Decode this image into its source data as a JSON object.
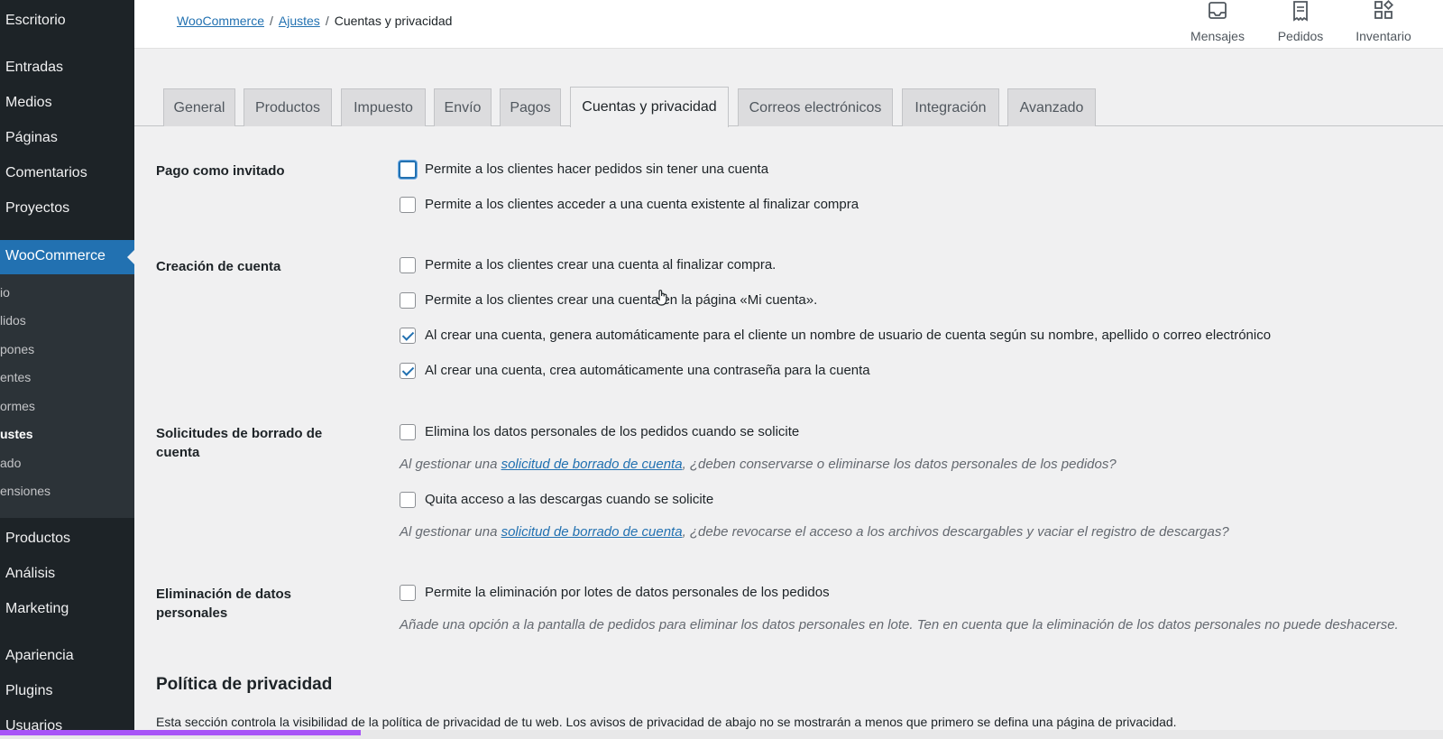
{
  "sidebar": {
    "top_items": [
      "Escritorio",
      "Entradas",
      "Medios",
      "Páginas",
      "Comentarios",
      "Proyectos"
    ],
    "active_item": "WooCommerce",
    "submenu": [
      "io",
      "lidos",
      "pones",
      "entes",
      "ormes",
      "ustes",
      "ado",
      "ensiones"
    ],
    "bottom_items": [
      "Productos",
      "Análisis",
      "Marketing",
      "Apariencia",
      "Plugins",
      "Usuarios"
    ]
  },
  "breadcrumb": {
    "link1": "WooCommerce",
    "link2": "Ajustes",
    "separator": "/",
    "current": "Cuentas y privacidad"
  },
  "top_actions": [
    {
      "label": "Mensajes",
      "icon": "inbox-icon"
    },
    {
      "label": "Pedidos",
      "icon": "orders-icon"
    },
    {
      "label": "Inventario",
      "icon": "inventory-icon"
    }
  ],
  "tabs": [
    "General",
    "Productos",
    "Impuesto",
    "Envío",
    "Pagos",
    "Cuentas y privacidad",
    "Correos electrónicos",
    "Integración",
    "Avanzado"
  ],
  "active_tab": "Cuentas y privacidad",
  "form": {
    "guest": {
      "label": "Pago como invitado",
      "opt1": "Permite a los clientes hacer pedidos sin tener una cuenta",
      "opt2": "Permite a los clientes acceder a una cuenta existente al finalizar compra"
    },
    "creation": {
      "label": "Creación de cuenta",
      "opt1": "Permite a los clientes crear una cuenta al finalizar compra.",
      "opt2": "Permite a los clientes crear una cuenta en la página «Mi cuenta».",
      "opt3": "Al crear una cuenta, genera automáticamente para el cliente un nombre de usuario de cuenta según su nombre, apellido o correo electrónico",
      "opt4": "Al crear una cuenta, crea automáticamente una contraseña para la cuenta"
    },
    "erasure": {
      "label": "Solicitudes de borrado de cuenta",
      "opt1": "Elimina los datos personales de los pedidos cuando se solicite",
      "desc1_pre": "Al gestionar una ",
      "desc1_link": "solicitud de borrado de cuenta",
      "desc1_post": ", ¿deben conservarse o eliminarse los datos personales de los pedidos?",
      "opt2": "Quita acceso a las descargas cuando se solicite",
      "desc2_pre": "Al gestionar una ",
      "desc2_link": "solicitud de borrado de cuenta",
      "desc2_post": ", ¿debe revocarse el acceso a los archivos descargables y vaciar el registro de descargas?"
    },
    "personal_data": {
      "label": "Eliminación de datos personales",
      "opt1": "Permite la eliminación por lotes de datos personales de los pedidos",
      "desc": "Añade una opción a la pantalla de pedidos para eliminar los datos personales en lote. Ten en cuenta que la eliminación de los datos personales no puede deshacerse."
    }
  },
  "privacy": {
    "title": "Política de privacidad",
    "desc": "Esta sección controla la visibilidad de la política de privacidad de tu web. Los avisos de privacidad de abajo no se mostrarán a menos que primero se defina una página de privacidad."
  },
  "checkbox_states": {
    "guest_opt1": false,
    "guest_opt2": false,
    "creation_opt1": false,
    "creation_opt2": false,
    "creation_opt3": true,
    "creation_opt4": true,
    "erasure_opt1": false,
    "erasure_opt2": false,
    "personal_opt1": false
  },
  "scroll_progress": 0.25,
  "colors": {
    "accent": "#2271b1",
    "sidebar": "#1d2327",
    "submenu": "#2c3338",
    "progress": "#a855f7"
  }
}
